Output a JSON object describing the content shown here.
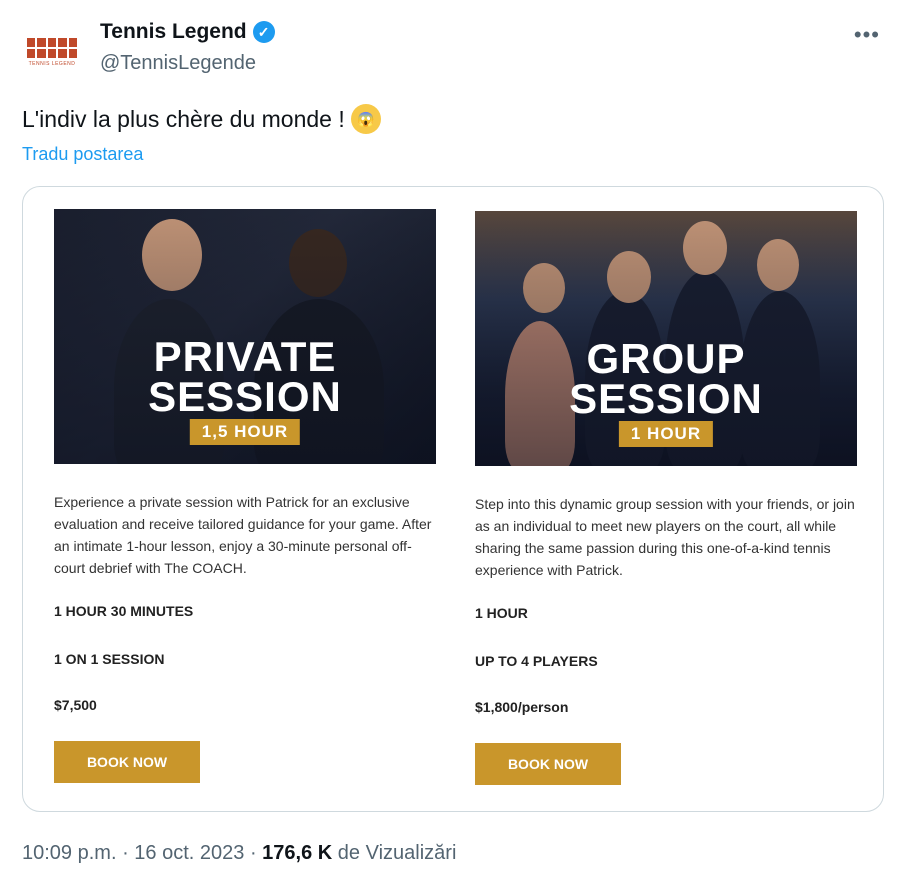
{
  "author": {
    "name": "Tennis Legend",
    "handle": "@TennisLegende",
    "avatar_caption": "TENNIS LEGEND",
    "verified_icon": "verified-check-icon"
  },
  "tweet": {
    "text": "L'indiv la plus chère du monde !",
    "emoji": "face-screaming-in-fear-icon",
    "translate_link": "Tradu postarea",
    "more_label": "•••"
  },
  "offers": [
    {
      "image_title_line1": "PRIVATE",
      "image_title_line2": "SESSION",
      "image_badge": "1,5 HOUR",
      "description": "Experience a private session with Patrick for an exclusive evaluation and receive tailored guidance for your game. After an intimate 1-hour lesson, enjoy a 30-minute personal off-court debrief with The COACH.",
      "duration": "1 HOUR 30 MINUTES",
      "format": "1 ON 1 SESSION",
      "price": "$7,500",
      "button": "BOOK NOW"
    },
    {
      "image_title_line1": "GROUP",
      "image_title_line2": "SESSION",
      "image_badge": "1 HOUR",
      "description": "Step into this dynamic group session with your friends, or join as an individual to meet new players on the court, all while sharing the same passion during this one-of-a-kind tennis experience with Patrick.",
      "duration": "1 HOUR",
      "format": "UP TO 4 PLAYERS",
      "price": "$1,800/person",
      "button": "BOOK NOW"
    }
  ],
  "footer": {
    "time": "10:09 p.m.",
    "separator": " · ",
    "date": "16 oct. 2023",
    "views_count": "176,6 K",
    "views_label": "de Vizualizări"
  },
  "colors": {
    "accent_gold": "#c9962b",
    "link_blue": "#1d9bf0",
    "muted_gray": "#536471"
  }
}
